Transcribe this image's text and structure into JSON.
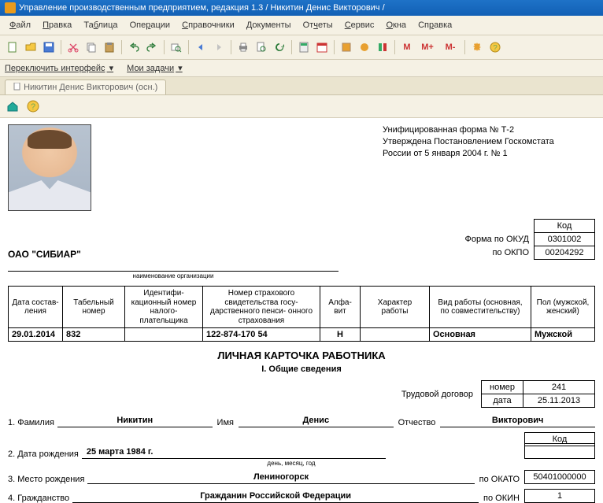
{
  "title": "Управление производственным предприятием, редакция 1.3 / Никитин Денис Викторович /",
  "menu": [
    "Файл",
    "Правка",
    "Таблица",
    "Операции",
    "Справочники",
    "Документы",
    "Отчеты",
    "Сервис",
    "Окна",
    "Справка"
  ],
  "sub": {
    "switch": "Переключить интерфейс",
    "tasks": "Мои задачи"
  },
  "tab": "Никитин Денис Викторович (осн.)",
  "toolbarText": {
    "m": "M",
    "mplus": "M+",
    "mminus": "M-"
  },
  "formRef": {
    "l1": "Унифицированная форма № Т-2",
    "l2": "Утверждена Постановлением Госкомстата",
    "l3": "России от 5 января 2004 г. № 1"
  },
  "kodHeader": "Код",
  "okud": {
    "label": "Форма по ОКУД",
    "value": "0301002"
  },
  "okpo": {
    "label": "по ОКПО",
    "value": "00204292"
  },
  "org": "ОАО \"СИБИАР\"",
  "orgCap": "наименование организации",
  "mainHead": [
    "Дата состав-\nления",
    "Табельный номер",
    "Идентифи-\nкационный номер налого-\nплательщика",
    "Номер страхового свидетельства госу-\nдарственного пенси-\nонного страхования",
    "Алфа-\nвит",
    "Характер работы",
    "Вид работы (основная, по совместительству)",
    "Пол (мужской, женский)"
  ],
  "mainRow": [
    "29.01.2014",
    "832",
    "",
    "122-874-170 54",
    "Н",
    "",
    "Основная",
    "Мужской"
  ],
  "cardTitle": "ЛИЧНАЯ КАРТОЧКА РАБОТНИКА",
  "sec1": "I. Общие сведения",
  "contract": {
    "label": "Трудовой договор",
    "numLab": "номер",
    "num": "241",
    "dateLab": "дата",
    "date": "25.11.2013"
  },
  "fio": {
    "n1": "1. Фамилия",
    "v1": "Никитин",
    "n2": "Имя",
    "v2": "Денис",
    "n3": "Отчество",
    "v3": "Викторович"
  },
  "kod2": "Код",
  "dob": {
    "label": "2. Дата рождения",
    "value": "25 марта 1984 г.",
    "cap": "день, месяц, год"
  },
  "pob": {
    "label": "3. Место рождения",
    "value": "Лениногорск",
    "codeLab": "по ОКАТО",
    "code": "50401000000"
  },
  "cit": {
    "label": "4. Гражданство",
    "value": "Гражданин Российской Федерации",
    "codeLab": "по ОКИН",
    "code": "1"
  }
}
